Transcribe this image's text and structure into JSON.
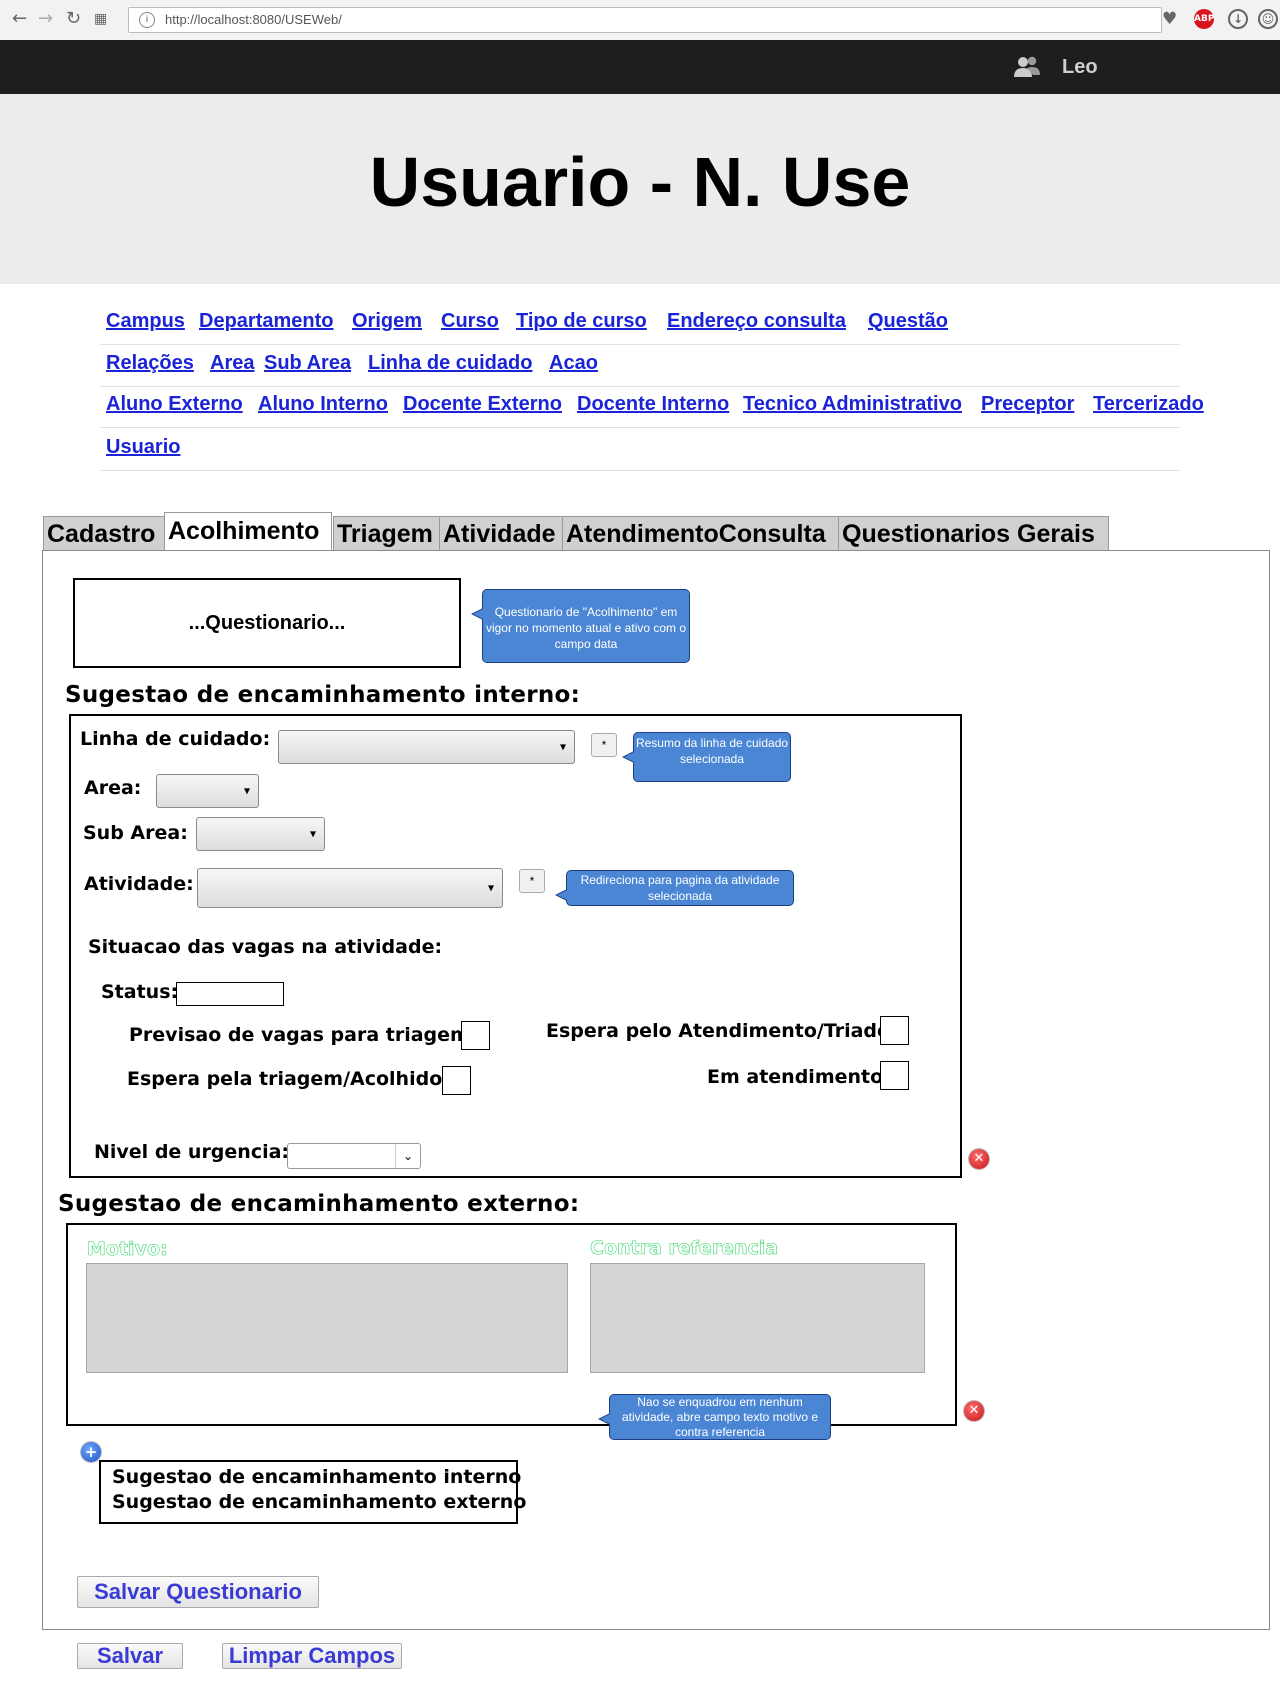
{
  "browser": {
    "url": "http://localhost:8080/USEWeb/"
  },
  "topbar": {
    "user_name": "Leo"
  },
  "header": {
    "title": "Usuario - N. Use"
  },
  "menu": {
    "row1": [
      "Campus",
      "Departamento",
      "Origem",
      "Curso",
      "Tipo de curso",
      "Endereço consulta",
      "Questão"
    ],
    "row2": [
      "Relações",
      "Area",
      "Sub Area",
      "Linha de cuidado",
      "Acao"
    ],
    "row3": [
      "Aluno Externo",
      "Aluno Interno",
      "Docente Externo",
      "Docente Interno",
      "Tecnico Administrativo",
      "Preceptor",
      "Tercerizado"
    ],
    "row4": [
      "Usuario"
    ]
  },
  "tabs": [
    "Cadastro",
    "Acolhimento",
    "Triagem",
    "Atividade",
    "AtendimentoConsulta",
    "Questionarios Gerais"
  ],
  "active_tab": "Acolhimento",
  "questionario": {
    "box_label": "...Questionario...",
    "note": "Questionario de \"Acolhimento\" em vigor no momento atual e ativo com o campo data"
  },
  "interno": {
    "title": "Sugestao de encaminhamento interno:",
    "linha_label": "Linha de cuidado:",
    "linha_note": "Resumo da linha de cuidado selecionada",
    "area_label": "Area:",
    "subarea_label": "Sub Area:",
    "atividade_label": "Atividade:",
    "atividade_note": "Redireciona para pagina da atividade selecionada",
    "star": "*",
    "situacao_label": "Situacao das vagas na atividade:",
    "status_label": "Status:",
    "previsao_label": "Previsao de vagas para triagem:",
    "espera_triagem_label": "Espera pela triagem/Acolhido:",
    "espera_atendimento_label": "Espera pelo Atendimento/Triado:",
    "em_atendimento_label": "Em atendimento:",
    "urgencia_label": "Nivel de urgencia:"
  },
  "externo": {
    "title": "Sugestao de encaminhamento externo:",
    "motivo_label": "Motivo:",
    "contra_label": "Contra referencia",
    "note": "Nao se enquadrou em nenhum atividade, abre campo texto motivo e contra referencia"
  },
  "add_menu": {
    "items": [
      "Sugestao de encaminhamento interno",
      "Sugestao de encaminhamento externo"
    ]
  },
  "buttons": {
    "salvar_questionario": "Salvar Questionario",
    "salvar": "Salvar",
    "limpar": "Limpar Campos"
  },
  "colors": {
    "link": "#1a24d6",
    "note_bg": "#4a86d4",
    "topbar": "#1e1e1e",
    "header_bg": "#ececec",
    "delete_icon": "#c4161c",
    "add_icon": "#1c54c4"
  }
}
